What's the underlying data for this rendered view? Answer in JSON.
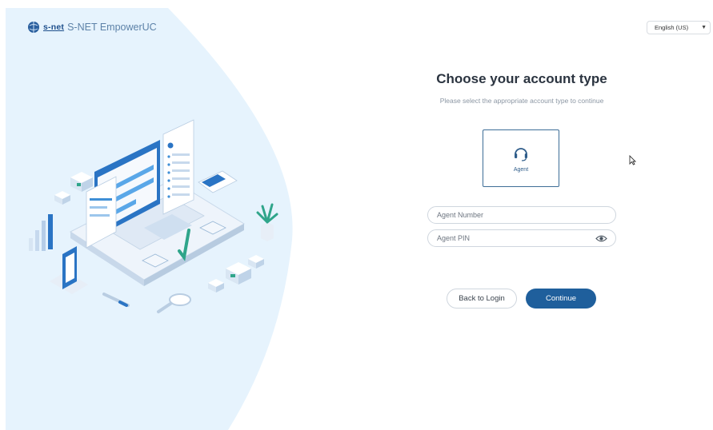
{
  "header": {
    "logo_word": "s-net",
    "product_name": "S-NET EmpowerUC",
    "language": {
      "selected": "English (US)"
    }
  },
  "main": {
    "title": "Choose your account type",
    "subtitle": "Please select the appropriate account type to continue",
    "account_types": [
      {
        "label": "Agent",
        "icon": "headset-icon",
        "selected": true
      }
    ],
    "fields": {
      "agent_number": {
        "placeholder": "Agent Number",
        "value": ""
      },
      "agent_pin": {
        "placeholder": "Agent PIN",
        "value": "",
        "toggle_icon": "eye-icon"
      }
    },
    "buttons": {
      "back": "Back to Login",
      "continue": "Continue"
    }
  },
  "colors": {
    "primary": "#1f5f9c",
    "panel_bg": "#e8f4fd",
    "card_border": "#3d6d97",
    "title": "#2b3440"
  }
}
